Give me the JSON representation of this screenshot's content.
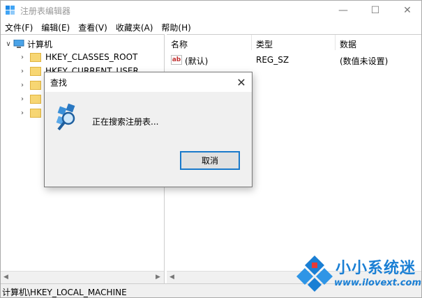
{
  "window": {
    "title": "注册表编辑器",
    "minimize_glyph": "—",
    "maximize_glyph": "☐",
    "close_glyph": "✕"
  },
  "menu": [
    {
      "label": "文件(F)"
    },
    {
      "label": "编辑(E)"
    },
    {
      "label": "查看(V)"
    },
    {
      "label": "收藏夹(A)"
    },
    {
      "label": "帮助(H)"
    }
  ],
  "tree": {
    "root_label": "计算机",
    "nodes": [
      {
        "label": "HKEY_CLASSES_ROOT"
      },
      {
        "label": "HKEY_CURRENT_USER"
      },
      {
        "label": ""
      },
      {
        "label": ""
      },
      {
        "label": ""
      }
    ]
  },
  "list": {
    "columns": [
      {
        "label": "名称"
      },
      {
        "label": "类型"
      },
      {
        "label": "数据"
      }
    ],
    "rows": [
      {
        "name": "(默认)",
        "type": "REG_SZ",
        "data": "(数值未设置)",
        "icon": "ab-string-icon"
      }
    ]
  },
  "status": {
    "path": "计算机\\HKEY_LOCAL_MACHINE"
  },
  "dialog": {
    "title": "查找",
    "message": "正在搜索注册表...",
    "cancel_label": "取消",
    "close_glyph": "✕"
  },
  "watermark": {
    "title": "小小系统迷",
    "url": "www.ilovext.com"
  },
  "colors": {
    "accent": "#1979ca",
    "folder": "#f7d673",
    "watermark": "#1a7fd4"
  }
}
